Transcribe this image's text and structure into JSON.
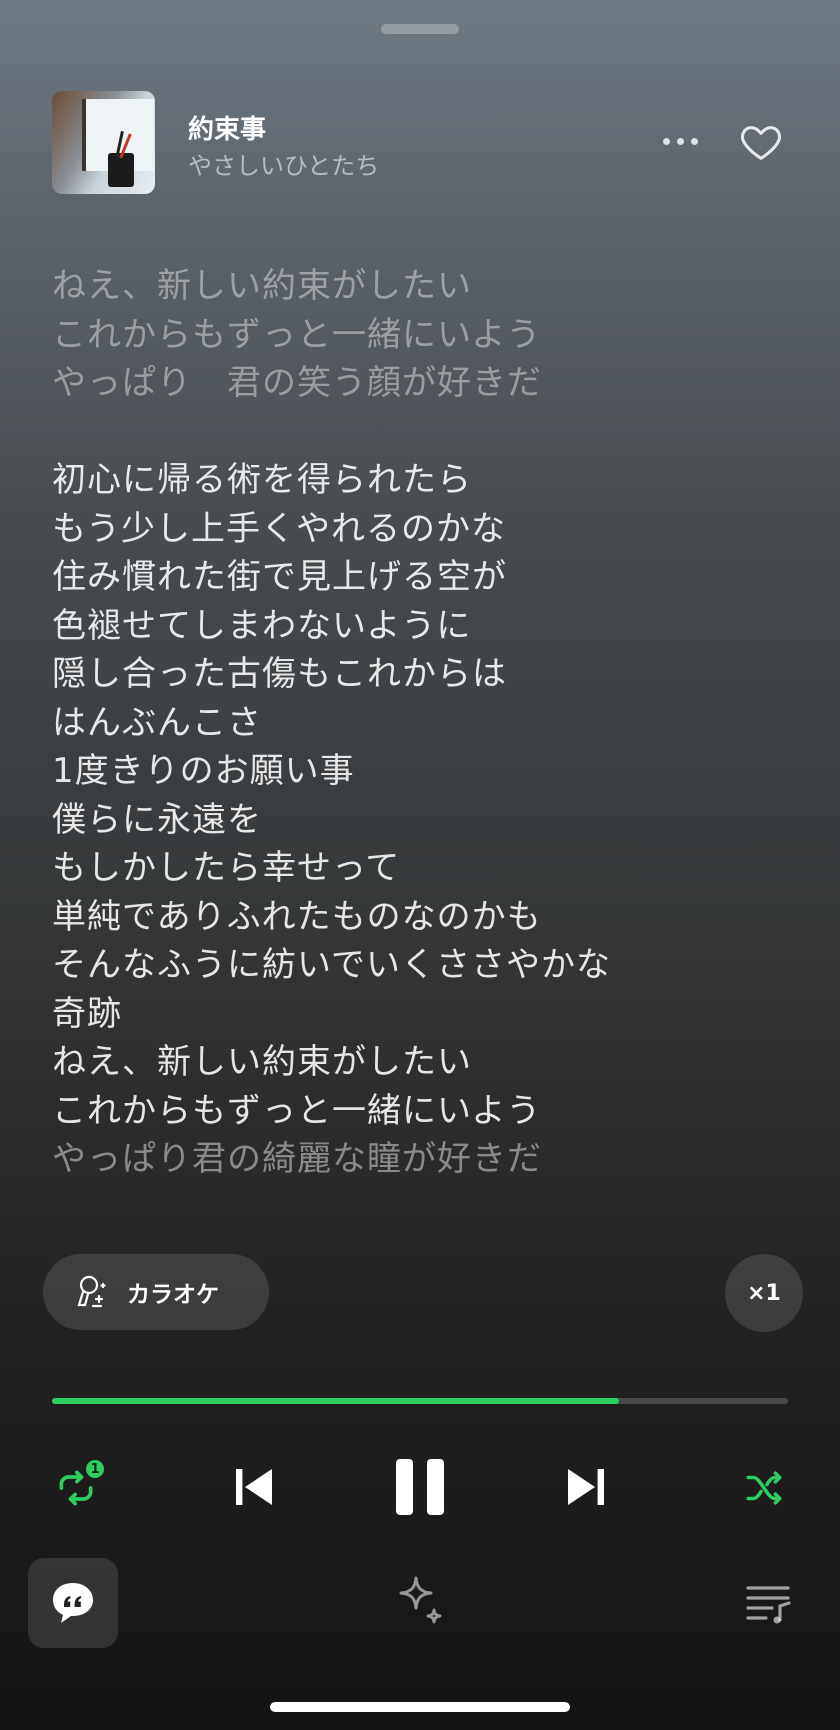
{
  "track": {
    "title": "約束事",
    "artist": "やさしいひとたち"
  },
  "lyrics": {
    "lines": [
      {
        "text": "ねえ、新しい約束がしたい",
        "style": "dim"
      },
      {
        "text": "これからもずっと一緒にいよう",
        "style": "dim"
      },
      {
        "text": "やっぱり　君の笑う顔が好きだ",
        "style": "dim"
      },
      {
        "text": "",
        "style": "normal"
      },
      {
        "text": "初心に帰る術を得られたら",
        "style": "normal"
      },
      {
        "text": "もう少し上手くやれるのかな",
        "style": "normal"
      },
      {
        "text": "住み慣れた街で見上げる空が",
        "style": "normal"
      },
      {
        "text": "色褪せてしまわないように",
        "style": "normal"
      },
      {
        "text": "隠し合った古傷もこれからは",
        "style": "normal"
      },
      {
        "text": "はんぶんこさ",
        "style": "normal"
      },
      {
        "text": "1度きりのお願い事",
        "style": "normal"
      },
      {
        "text": "僕らに永遠を",
        "style": "normal"
      },
      {
        "text": "もしかしたら幸せって",
        "style": "normal"
      },
      {
        "text": "単純でありふれたものなのかも",
        "style": "normal"
      },
      {
        "text": "そんなふうに紡いでいくささやかな",
        "style": "normal"
      },
      {
        "text": "奇跡",
        "style": "normal"
      },
      {
        "text": "ねえ、新しい約束がしたい",
        "style": "normal"
      },
      {
        "text": "これからもずっと一緒にいよう",
        "style": "normal"
      },
      {
        "text": "やっぱり君の綺麗な瞳が好きだ",
        "style": "faint"
      }
    ]
  },
  "karaoke": {
    "label": "カラオケ"
  },
  "speed": {
    "label": "×1"
  },
  "playback": {
    "progress": 0.77,
    "repeat_badge": "1",
    "state": "playing"
  },
  "icons": {
    "more": "more-icon",
    "like": "heart-icon",
    "karaoke": "karaoke-mic-icon",
    "repeat": "repeat-one-icon",
    "prev": "skip-previous-icon",
    "pause": "pause-icon",
    "next": "skip-next-icon",
    "shuffle": "shuffle-icon",
    "lyrics": "lyrics-quote-icon",
    "ai": "sparkle-icon",
    "queue": "queue-music-icon"
  },
  "colors": {
    "accent": "#2fcc62"
  }
}
